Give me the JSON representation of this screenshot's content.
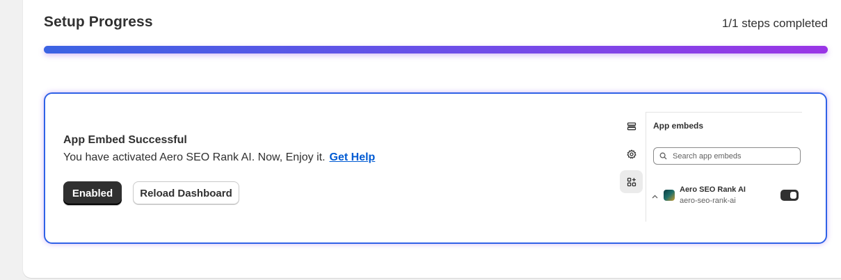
{
  "header": {
    "title": "Setup Progress",
    "steps_text": "1/1 steps completed",
    "progress_fraction": 1.0
  },
  "embed": {
    "title": "App Embed Successful",
    "description": "You have activated Aero SEO Rank AI. Now, Enjoy it.",
    "help_link": "Get Help",
    "enabled_button": "Enabled",
    "reload_button": "Reload Dashboard"
  },
  "preview": {
    "rail_icons": [
      "sections-icon",
      "gear-icon",
      "app-embed-icon"
    ],
    "heading": "App embeds",
    "search_placeholder": "Search app embeds",
    "app_name": "Aero SEO Rank AI",
    "app_handle": "aero-seo-rank-ai",
    "toggle_on": true
  },
  "colors": {
    "accent_border": "#2f62e6",
    "progress_start": "#3b63e3",
    "progress_end": "#9a35e6",
    "link": "#005bd3"
  }
}
